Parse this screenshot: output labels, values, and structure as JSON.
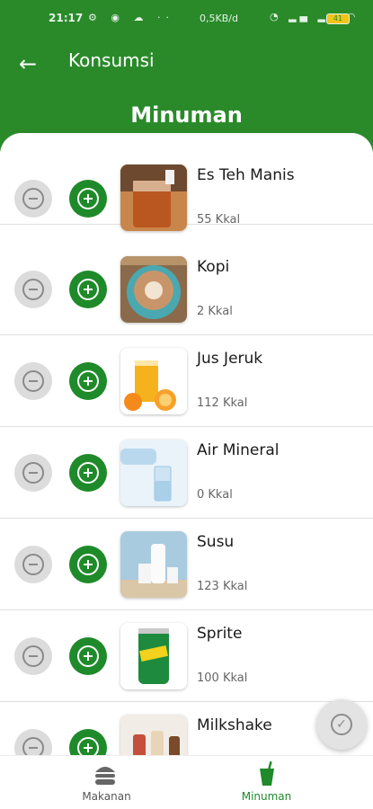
{
  "status_bar": {
    "time": "21:17",
    "net_speed": "0,5KB/d",
    "battery": "41"
  },
  "app_bar": {
    "title": "Konsumsi",
    "back_icon": "arrow-left-icon"
  },
  "section_title": "Minuman",
  "items": [
    {
      "name": "Es Teh Manis",
      "kcal": "55 Kkal",
      "image": "iced-tea"
    },
    {
      "name": "Kopi",
      "kcal": "2 Kkal",
      "image": "coffee"
    },
    {
      "name": "Jus Jeruk",
      "kcal": "112 Kkal",
      "image": "orange-juice"
    },
    {
      "name": "Air Mineral",
      "kcal": "0 Kkal",
      "image": "water"
    },
    {
      "name": "Susu",
      "kcal": "123 Kkal",
      "image": "milk"
    },
    {
      "name": "Sprite",
      "kcal": "100 Kkal",
      "image": "sprite-can"
    },
    {
      "name": "Milkshake",
      "kcal": "",
      "image": "milkshake"
    }
  ],
  "bottom_nav": {
    "food_label": "Makanan",
    "drink_label": "Minuman",
    "active": "drink"
  },
  "colors": {
    "primary": "#2a8a2a",
    "inactive": "#dcdcdc"
  }
}
